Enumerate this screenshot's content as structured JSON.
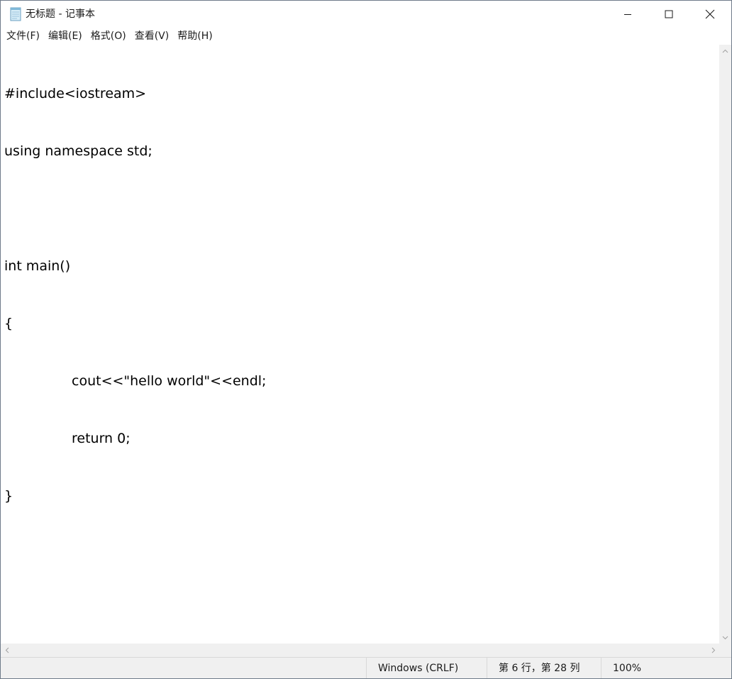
{
  "window": {
    "title": "无标题 - 记事本"
  },
  "menu": {
    "items": [
      {
        "label": "文件(F)"
      },
      {
        "label": "编辑(E)"
      },
      {
        "label": "格式(O)"
      },
      {
        "label": "查看(V)"
      },
      {
        "label": "帮助(H)"
      }
    ]
  },
  "editor": {
    "lines": [
      "#include<iostream>",
      "using namespace std;",
      "",
      "int main()",
      "{",
      "cout<<\"hello world\"<<endl;",
      "return 0;",
      "}"
    ]
  },
  "status": {
    "encoding": "Windows (CRLF)",
    "position": "第 6 行，第 28 列",
    "zoom": "100%"
  },
  "icons": {
    "app": "notepad-icon",
    "minimize": "minimize-icon",
    "maximize": "maximize-icon",
    "close": "close-icon"
  }
}
